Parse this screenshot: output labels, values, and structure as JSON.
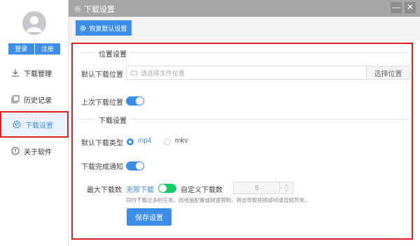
{
  "sidebar": {
    "login_label": "登录",
    "register_label": "注册",
    "items": [
      {
        "label": "下载管理",
        "icon": "download-icon"
      },
      {
        "label": "历史记录",
        "icon": "history-icon"
      },
      {
        "label": "下载设置",
        "icon": "gear-icon",
        "active": true
      },
      {
        "label": "关于软件",
        "icon": "info-icon"
      }
    ]
  },
  "window": {
    "title": "下载设置",
    "minimize": "—",
    "close": "✕"
  },
  "toolbar": {
    "restore_label": "恢复默认设置"
  },
  "settings": {
    "location_section": "位置设置",
    "default_location_label": "默认下载位置",
    "location_placeholder": "请选择文件位置",
    "choose_location_label": "选择位置",
    "last_location_label": "上次下载位置",
    "download_section": "下载设置",
    "default_type_label": "默认下载类型",
    "type_options": [
      "mp4",
      "mkv"
    ],
    "selected_type": "mp4",
    "notify_label": "下载完成通知",
    "max_downloads_label": "最大下载数",
    "unlimited_label": "无限下载",
    "custom_label": "自定义下载数",
    "custom_value": "5",
    "hint": "同时下载过多的任务，因电脑配置或网速限制，将会导致视频掉帧或音频异常。",
    "save_label": "保存设置"
  },
  "colors": {
    "accent": "#3d8ee8",
    "highlight_border": "#e02020",
    "toggle_green": "#13ce66",
    "titlebar": "#a6a6a6"
  }
}
